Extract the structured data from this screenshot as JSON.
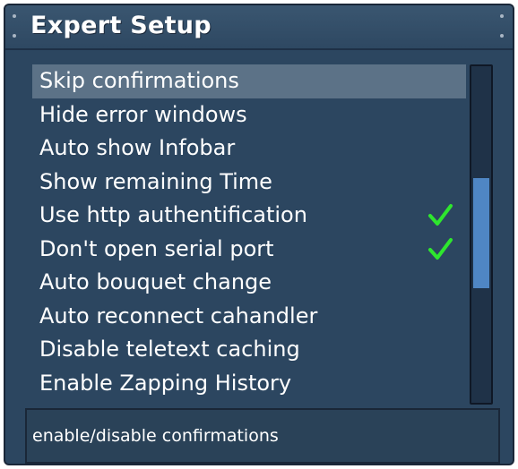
{
  "window": {
    "title": "Expert Setup"
  },
  "menu": {
    "items": [
      {
        "label": "Skip confirmations",
        "checked": false,
        "selected": true
      },
      {
        "label": "Hide error windows",
        "checked": false,
        "selected": false
      },
      {
        "label": "Auto show Infobar",
        "checked": false,
        "selected": false
      },
      {
        "label": "Show remaining Time",
        "checked": false,
        "selected": false
      },
      {
        "label": "Use http authentification",
        "checked": true,
        "selected": false
      },
      {
        "label": "Don't open serial port",
        "checked": true,
        "selected": false
      },
      {
        "label": "Auto bouquet change",
        "checked": false,
        "selected": false
      },
      {
        "label": "Auto reconnect cahandler",
        "checked": false,
        "selected": false
      },
      {
        "label": "Disable teletext caching",
        "checked": false,
        "selected": false
      },
      {
        "label": "Enable Zapping History",
        "checked": false,
        "selected": false
      }
    ]
  },
  "scrollbar": {
    "position_fraction": 0.33,
    "visible_fraction": 0.33
  },
  "status": {
    "text": "enable/disable confirmations"
  },
  "colors": {
    "background": "#2c4660",
    "selection": "#5c7287",
    "checkmark": "#2ee62e",
    "scroll_thumb": "#4f86c4"
  },
  "icons": {
    "checked": "checkmark-icon"
  }
}
